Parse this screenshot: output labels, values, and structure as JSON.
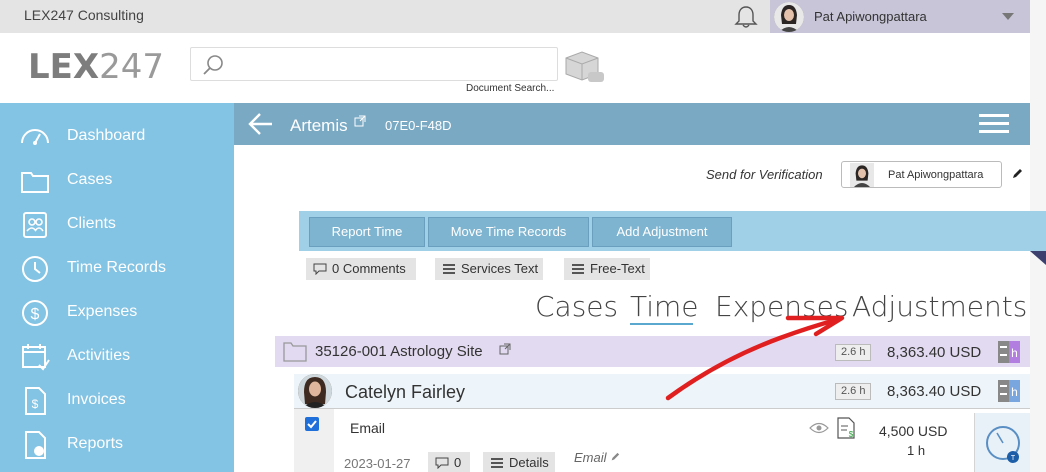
{
  "topbar": {
    "company": "LEX247 Consulting",
    "user_name": "Pat Apiwongpattara"
  },
  "header": {
    "logo_bold": "LEX",
    "logo_thin": "247",
    "search_placeholder": "",
    "search_hint": "Document Search..."
  },
  "sidebar": {
    "items": [
      {
        "label": "Dashboard",
        "icon": "gauge-icon"
      },
      {
        "label": "Cases",
        "icon": "folder-icon"
      },
      {
        "label": "Clients",
        "icon": "contacts-icon"
      },
      {
        "label": "Time Records",
        "icon": "clock-icon"
      },
      {
        "label": "Expenses",
        "icon": "dollar-icon"
      },
      {
        "label": "Activities",
        "icon": "calendar-icon"
      },
      {
        "label": "Invoices",
        "icon": "invoice-icon"
      },
      {
        "label": "Reports",
        "icon": "report-icon"
      }
    ]
  },
  "case": {
    "title": "Artemis",
    "code": "07E0-F48D"
  },
  "verification": {
    "label": "Send for Verification",
    "user": "Pat Apiwongpattara"
  },
  "actions": [
    "Report Time",
    "Move Time Records",
    "Add Adjustment"
  ],
  "tags": [
    "0 Comments",
    "Services Text",
    "Free-Text"
  ],
  "tabs": [
    "Cases",
    "Time",
    "Expenses",
    "Adjustments"
  ],
  "active_tab": "Time",
  "case_row": {
    "name": "35126-001 Astrology Site",
    "hours": "2.6 h",
    "amount": "8,363.40 USD"
  },
  "person_row": {
    "name": "Catelyn Fairley",
    "hours": "2.6 h",
    "amount": "8,363.40 USD"
  },
  "record": {
    "type": "Email",
    "date": "2023-01-27",
    "comments": "0",
    "details": "Details",
    "tag": "Email",
    "amount": "4,500 USD",
    "hours": "1 h",
    "checked": true
  },
  "colors": {
    "sidebar": "#83c3e3",
    "casebar": "#7aa9c4",
    "actionbar": "#9fd0e8",
    "caserow": "#e2daf0",
    "accent_underline": "#5aa7d0",
    "annotation_arrow": "#e02020"
  }
}
